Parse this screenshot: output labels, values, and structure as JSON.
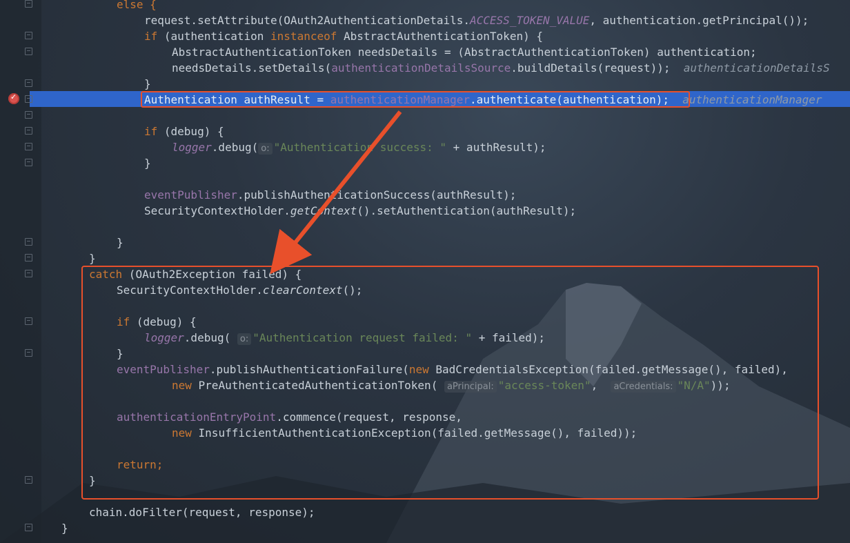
{
  "editor": {
    "lines": [
      {
        "k": "l0",
        "parts": [
          {
            "t": "else {",
            "c": "kw-first"
          }
        ]
      },
      {
        "k": "l1",
        "parts": [
          {
            "t": "request.setAttribute(OAuth2AuthenticationDetails."
          },
          {
            "t": "ACCESS_TOKEN_VALUE",
            "c": "st"
          },
          {
            "t": ", authentication.getPrincipal());"
          }
        ]
      },
      {
        "k": "l2",
        "parts": [
          {
            "t": "if",
            "c": "kw"
          },
          {
            "t": " (authentication "
          },
          {
            "t": "instanceof",
            "c": "kw"
          },
          {
            "t": " AbstractAuthenticationToken) {"
          }
        ]
      },
      {
        "k": "l3",
        "parts": [
          {
            "t": "AbstractAuthenticationToken needsDetails = (AbstractAuthenticationToken) authentication;"
          }
        ]
      },
      {
        "k": "l4",
        "parts": [
          {
            "t": "needsDetails.setDetails("
          },
          {
            "t": "authenticationDetailsSource",
            "c": "fld"
          },
          {
            "t": ".buildDetails(request));"
          }
        ],
        "inline": "authenticationDetailsS"
      },
      {
        "k": "l5",
        "parts": [
          {
            "t": "}"
          }
        ]
      },
      {
        "k": "l6",
        "parts": [
          {
            "t": "Authentication authResult = "
          },
          {
            "t": "authenticationManager",
            "c": "fld"
          },
          {
            "t": ".authenticate(authentication);"
          }
        ],
        "inline": "authenticationManager"
      },
      {
        "k": "l7",
        "parts": []
      },
      {
        "k": "l8",
        "parts": [
          {
            "t": "if",
            "c": "kw"
          },
          {
            "t": " (debug) {"
          }
        ]
      },
      {
        "k": "l9",
        "parts": [
          {
            "t": "logger",
            "c": "st"
          },
          {
            "t": ".debug("
          },
          {
            "t": "o:",
            "c": "hint"
          },
          {
            "t": "\"Authentication success: \"",
            "c": "str"
          },
          {
            "t": " + authResult);"
          }
        ]
      },
      {
        "k": "l10",
        "parts": [
          {
            "t": "}"
          }
        ]
      },
      {
        "k": "l11",
        "parts": []
      },
      {
        "k": "l12",
        "parts": [
          {
            "t": "eventPublisher",
            "c": "fld"
          },
          {
            "t": ".publishAuthenticationSuccess(authResult);"
          }
        ]
      },
      {
        "k": "l13",
        "parts": [
          {
            "t": "SecurityContextHolder."
          },
          {
            "t": "getContext",
            "c": "it"
          },
          {
            "t": "().setAuthentication(authResult);"
          }
        ]
      },
      {
        "k": "l14",
        "parts": []
      },
      {
        "k": "l15",
        "parts": [
          {
            "t": "}"
          }
        ]
      },
      {
        "k": "l16",
        "parts": [
          {
            "t": "}"
          }
        ]
      },
      {
        "k": "l17",
        "parts": [
          {
            "t": "catch",
            "c": "kw"
          },
          {
            "t": " (OAuth2Exception failed) {"
          }
        ]
      },
      {
        "k": "l18",
        "parts": [
          {
            "t": "SecurityContextHolder."
          },
          {
            "t": "clearContext",
            "c": "it"
          },
          {
            "t": "();"
          }
        ]
      },
      {
        "k": "l19",
        "parts": []
      },
      {
        "k": "l20",
        "parts": [
          {
            "t": "if",
            "c": "kw"
          },
          {
            "t": " (debug) {"
          }
        ]
      },
      {
        "k": "l21",
        "parts": [
          {
            "t": "logger",
            "c": "st"
          },
          {
            "t": ".debug( "
          },
          {
            "t": "o:",
            "c": "hint"
          },
          {
            "t": "\"Authentication request failed: \"",
            "c": "str"
          },
          {
            "t": " + failed);"
          }
        ]
      },
      {
        "k": "l22",
        "parts": [
          {
            "t": "}"
          }
        ]
      },
      {
        "k": "l23",
        "parts": [
          {
            "t": "eventPublisher",
            "c": "fld"
          },
          {
            "t": ".publishAuthenticationFailure("
          },
          {
            "t": "new",
            "c": "kw"
          },
          {
            "t": " BadCredentialsException(failed.getMessage(), failed),"
          }
        ]
      },
      {
        "k": "l24",
        "parts": [
          {
            "t": "new",
            "c": "kw"
          },
          {
            "t": " PreAuthenticatedAuthenticationToken( "
          },
          {
            "t": "aPrincipal:",
            "c": "hint"
          },
          {
            "t": "\"access-token\"",
            "c": "str"
          },
          {
            "t": ",  "
          },
          {
            "t": "aCredentials:",
            "c": "hint"
          },
          {
            "t": "\"N/A\"",
            "c": "str"
          },
          {
            "t": "));"
          }
        ]
      },
      {
        "k": "l25",
        "parts": []
      },
      {
        "k": "l26",
        "parts": [
          {
            "t": "authenticationEntryPoint",
            "c": "fld"
          },
          {
            "t": ".commence(request, response,"
          }
        ]
      },
      {
        "k": "l27",
        "parts": [
          {
            "t": "new",
            "c": "kw"
          },
          {
            "t": " InsufficientAuthenticationException(failed.getMessage(), failed));"
          }
        ]
      },
      {
        "k": "l28",
        "parts": []
      },
      {
        "k": "l29",
        "parts": [
          {
            "t": "return;",
            "c": "kw"
          }
        ]
      },
      {
        "k": "l30",
        "parts": [
          {
            "t": "}"
          }
        ]
      },
      {
        "k": "l31",
        "parts": []
      },
      {
        "k": "l32",
        "parts": [
          {
            "t": "chain.doFilter(request, response);"
          }
        ]
      },
      {
        "k": "l33",
        "parts": [
          {
            "t": "}"
          }
        ]
      }
    ]
  },
  "colors": {
    "keyword": "#cc7832",
    "field": "#9876aa",
    "string": "#6a8759",
    "current_line": "#2f65ca",
    "annotation": "#e8502b"
  },
  "icons": {
    "breakpoint": "breakpoint-icon",
    "fold": "fold-marker-icon"
  }
}
